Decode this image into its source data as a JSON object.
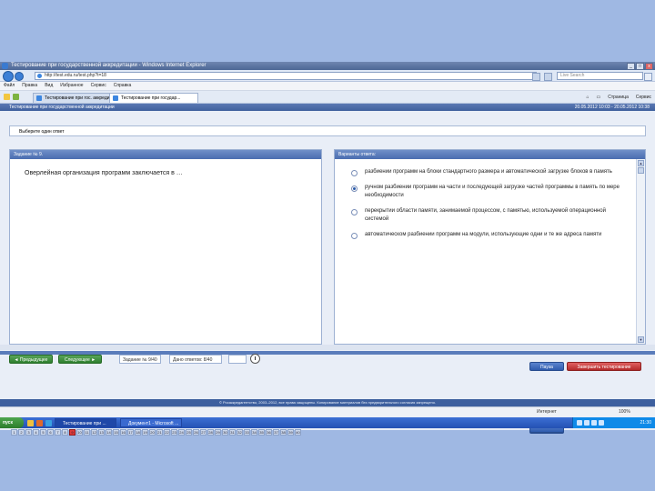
{
  "window": {
    "title": "Тестирование при государственной аккредитации - Windows Internet Explorer",
    "controls": [
      "_",
      "□",
      "x"
    ]
  },
  "addressbar": {
    "url": "http://test.edu.ru/test.php?t=18",
    "search_placeholder": "Live Search"
  },
  "menubar": {
    "items": [
      "Файл",
      "Правка",
      "Вид",
      "Избранное",
      "Сервис",
      "Справка"
    ]
  },
  "tabs": [
    {
      "label": "Тестирование при гос. аккредит..."
    },
    {
      "label": "Тестирование при государ..."
    }
  ],
  "tabtools": {
    "page_label": "Страница",
    "tools_label": "Сервис"
  },
  "app_header": {
    "title": "Тестирование при государственной аккредитации",
    "datetime": "20.05.2012 10:03 - 20.05.2012 10:38"
  },
  "info": {
    "text": "Выберите один ответ"
  },
  "question_panel": {
    "header": "Задание № 9.",
    "text": "Оверлейная организация программ заключается в …"
  },
  "answers_panel": {
    "header": "Варианты ответа:",
    "options": [
      {
        "text": "разбиении программ на блоки стандартного размера и автоматической загрузке блоков в память",
        "selected": false
      },
      {
        "text": "ручном разбиении программ на части и последующей загрузке частей программы в память по мере необходимости",
        "selected": true
      },
      {
        "text": "перекрытии области памяти, занимаемой процессом, с памятью, используемой операционной системой",
        "selected": false
      },
      {
        "text": "автоматическом разбиении программ на модули, использующие одни и те же адреса памяти",
        "selected": false
      }
    ]
  },
  "controls": {
    "prev_label": "◄ Предыдущее",
    "next_label": "Следующее ►",
    "task_field": "Задание № 9/40",
    "answered_field": "Дано ответов: 8/40",
    "pause_label": "Пауза",
    "finish_label": "Завершить тестирование"
  },
  "question_numbers": [
    "1",
    "2",
    "3",
    "4",
    "5",
    "6",
    "7",
    "8",
    "9",
    "10",
    "11",
    "12",
    "13",
    "14",
    "15",
    "16",
    "17",
    "18",
    "19",
    "20",
    "21",
    "22",
    "23",
    "24",
    "25",
    "26",
    "27",
    "28",
    "29",
    "30",
    "31",
    "32",
    "33",
    "34",
    "35",
    "36",
    "37",
    "38",
    "39",
    "40"
  ],
  "current_question": 9,
  "footer": {
    "text": "© Росаккредагентство, 2003–2012, все права защищены. Копирование материалов без предварительного согласия запрещено."
  },
  "statusbar": {
    "zone": "Интернет",
    "zoom": "100%"
  },
  "taskbar": {
    "start_label": "пуск",
    "tasks": [
      "Тестирование при ...",
      "Документ1 - Microsoft ..."
    ],
    "clock": "21:30"
  },
  "colors": {
    "background": "#9fb8e3",
    "header_blue": "#4a6db0",
    "green_button": "#2e7f2e",
    "red_button": "#b52b2b",
    "current_question": "#e03a3a"
  }
}
